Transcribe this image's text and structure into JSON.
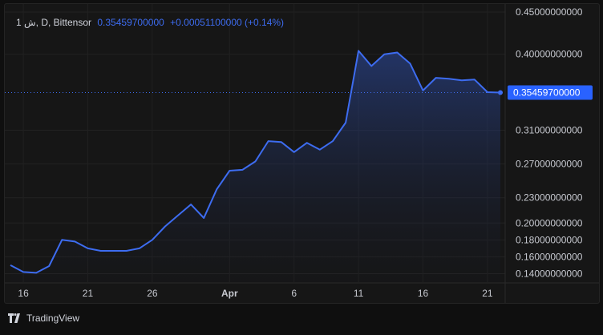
{
  "legend": {
    "symbol": "1 ش, D, Bittensor",
    "price": "0.35459700000",
    "change": "+0.00051100000 (+0.14%)"
  },
  "footer": {
    "brand": "TradingView",
    "logo_icon": "tradingview-logo-icon"
  },
  "colors": {
    "line": "#3d6cf0",
    "background": "#161616",
    "grid": "#232323",
    "text": "#d1d4dc"
  },
  "chart_data": {
    "type": "area",
    "title": "",
    "xlabel": "",
    "ylabel": "",
    "grid": true,
    "ylim": [
      0.13,
      0.45
    ],
    "y_tick_labels": [
      "0.45000000000",
      "0.40000000000",
      "0.35459700000",
      "0.31000000000",
      "0.27000000000",
      "0.23000000000",
      "0.20000000000",
      "0.18000000000",
      "0.16000000000",
      "0.14000000000"
    ],
    "x_tick_labels": [
      "16",
      "21",
      "26",
      "Apr",
      "6",
      "11",
      "16",
      "21"
    ],
    "last_price": 0.354597,
    "last_price_label": "0.35459700000",
    "series": [
      {
        "x": [
          "Mar 15",
          "Mar 16",
          "Mar 17",
          "Mar 18",
          "Mar 19",
          "Mar 20",
          "Mar 21",
          "Mar 22",
          "Mar 23",
          "Mar 24",
          "Mar 25",
          "Mar 26",
          "Mar 27",
          "Mar 28",
          "Mar 29",
          "Mar 30",
          "Mar 31",
          "Apr 1",
          "Apr 2",
          "Apr 3",
          "Apr 4",
          "Apr 5",
          "Apr 6",
          "Apr 7",
          "Apr 8",
          "Apr 9",
          "Apr 10",
          "Apr 11",
          "Apr 12",
          "Apr 13",
          "Apr 14",
          "Apr 15",
          "Apr 16",
          "Apr 17",
          "Apr 18",
          "Apr 19",
          "Apr 20",
          "Apr 21",
          "Apr 22"
        ],
        "values": [
          0.15,
          0.142,
          0.141,
          0.149,
          0.18,
          0.178,
          0.17,
          0.167,
          0.167,
          0.167,
          0.17,
          0.18,
          0.196,
          0.209,
          0.222,
          0.206,
          0.24,
          0.262,
          0.263,
          0.273,
          0.297,
          0.296,
          0.284,
          0.295,
          0.287,
          0.297,
          0.319,
          0.404,
          0.386,
          0.4,
          0.402,
          0.389,
          0.357,
          0.372,
          0.371,
          0.369,
          0.37,
          0.355,
          0.3546
        ]
      }
    ]
  }
}
